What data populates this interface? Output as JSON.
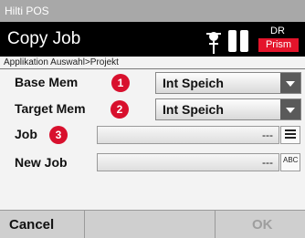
{
  "window": {
    "title": "Hilti POS"
  },
  "header": {
    "title": "Copy Job",
    "mode_label": "DR",
    "target_label": "Prism"
  },
  "breadcrumb": "Applikation Auswahl>Projekt",
  "form": {
    "base_mem": {
      "label": "Base Mem",
      "badge": "1",
      "value": "Int Speich"
    },
    "target_mem": {
      "label": "Target Mem",
      "badge": "2",
      "value": "Int Speich"
    },
    "job": {
      "label": "Job",
      "badge": "3",
      "value": "---"
    },
    "new_job": {
      "label": "New Job",
      "value": "---",
      "input_icon_text": "ABC"
    }
  },
  "softkeys": {
    "cancel": "Cancel",
    "ok": "OK"
  },
  "colors": {
    "header_bg": "#000000",
    "accent_red": "#d8102d",
    "titlebar_bg": "#a8a8a8"
  },
  "icons": [
    "prism-pole-icon",
    "battery-icon",
    "battery-icon",
    "list-icon",
    "keyboard-abc-icon",
    "dropdown-arrow-icon"
  ]
}
